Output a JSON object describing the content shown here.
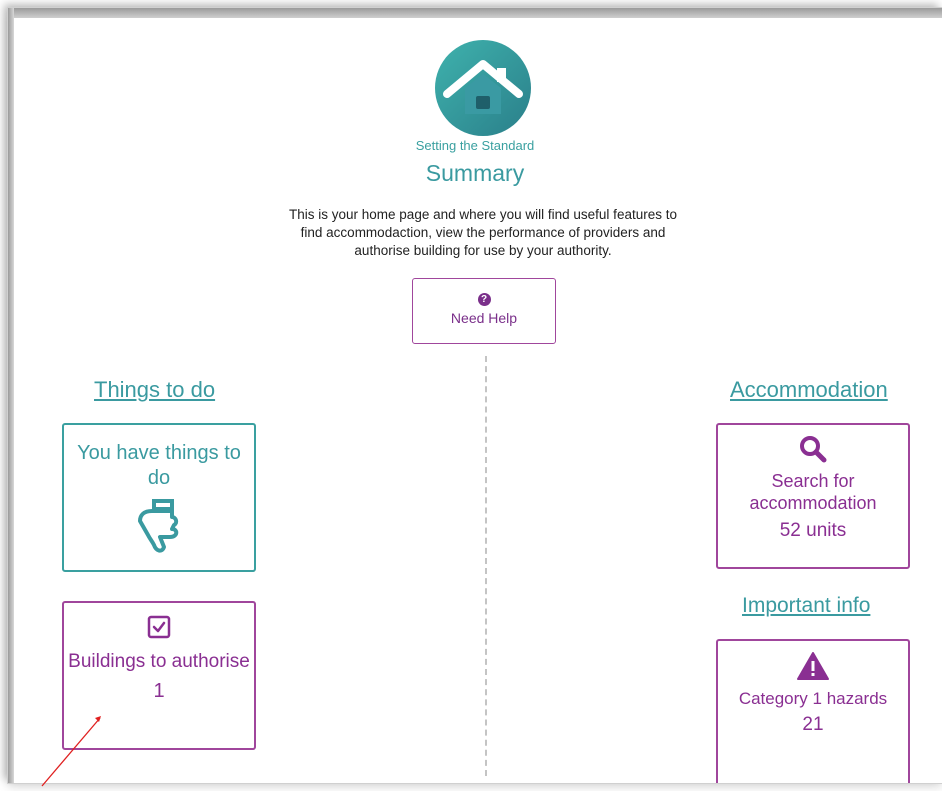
{
  "brand": "Setting the Standard",
  "page_title": "Summary",
  "intro": "This is your home page and where you will find useful features to find accommodaction, view the performance of providers and authorise building for use by your authority.",
  "help": {
    "label": "Need Help",
    "icon": "question-circle-icon"
  },
  "things_to_do": {
    "heading": "Things to do",
    "todo_card": {
      "label": "You have things to do",
      "icon": "pointing-hand-icon"
    },
    "buildings_card": {
      "label": "Buildings to authorise",
      "count": "1",
      "icon": "checkbox-icon"
    }
  },
  "accommodation": {
    "heading": "Accommodation",
    "search_card": {
      "label": "Search for accommodation",
      "count": "52 units",
      "icon": "search-icon"
    }
  },
  "important_info": {
    "heading": "Important info",
    "hazards_card": {
      "label": "Category 1 hazards",
      "count": "21",
      "icon": "warning-icon"
    }
  },
  "colors": {
    "teal": "#3aa0a0",
    "purple": "#8a2f92",
    "annotation_arrow": "#e02020"
  }
}
